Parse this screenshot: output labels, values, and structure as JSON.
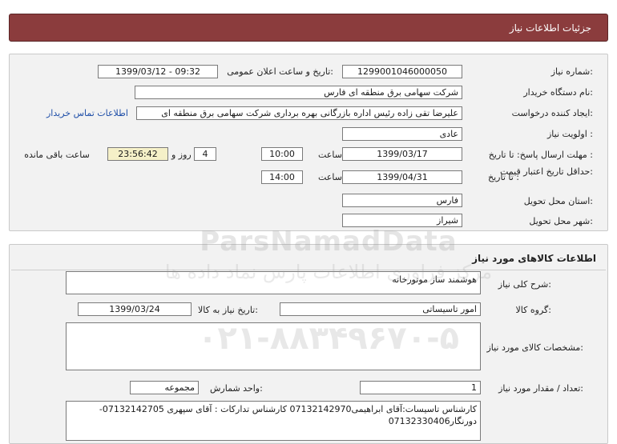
{
  "page_title": "جزئیات اطلاعات نیاز",
  "need_number": {
    "label": "شماره نیاز:",
    "value": "1299001046000050"
  },
  "announce_date": {
    "label": "تاریخ و ساعت اعلان عمومی:",
    "value": "1399/03/12 - 09:32"
  },
  "buyer_org": {
    "label": "نام دستگاه خریدار:",
    "value": "شرکت سهامی برق منطقه ای فارس"
  },
  "requester": {
    "label": "ایجاد کننده درخواست:",
    "value": "علیرضا  تقی زاده رئیس اداره بازرگانی بهره برداری شرکت سهامی برق منطقه ای",
    "contact_link": "اطلاعات تماس خریدار"
  },
  "priority": {
    "label": "اولویت نیاز :",
    "value": "عادی"
  },
  "response_deadline": {
    "label": "مهلت ارسال پاسخ:  تا تاریخ :",
    "date": "1399/03/17",
    "time_label": "ساعت",
    "time": "10:00",
    "days": "4",
    "days_label": "روز و",
    "remaining": "23:56:42",
    "remaining_label": "ساعت باقی مانده"
  },
  "price_validity": {
    "label": "حداقل تاریخ اعتبار قیمت:",
    "to_label": "تا تاریخ :",
    "date": "1399/04/31",
    "time_label": "ساعت",
    "time": "14:00"
  },
  "province": {
    "label": "استان محل تحویل:",
    "value": "فارس"
  },
  "city": {
    "label": "شهر محل تحویل:",
    "value": "شیراز"
  },
  "goods_section": {
    "title": "اطلاعات کالاهای مورد نیاز",
    "general_desc": {
      "label": "شرح کلی نیاز:",
      "value": "هوشمند ساز موتورخانه"
    },
    "goods_group": {
      "label": "گروه کالا:",
      "value": "امور تاسیساتی"
    },
    "need_date": {
      "label": "تاریخ نیاز به کالا:",
      "value": "1399/03/24"
    },
    "specs": {
      "label": "مشخصات کالای مورد نیاز:",
      "value": ""
    },
    "quantity": {
      "label": "تعداد / مقدار مورد نیاز:",
      "value": "1"
    },
    "unit": {
      "label": "واحد شمارش:",
      "value": "مجموعه"
    },
    "buyer_notes": {
      "value": "کارشناس تاسیسات:آقای ابراهیمی07132142970 کارشناس تدارکات : آقای سپهری 07132142705-دورنگار07132330406"
    }
  },
  "watermark": {
    "brand": "ParsNamadData",
    "line2": "مرکز فراوری اطلاعات پارس نماد داده ها",
    "phone": "۰۲۱-۸۸۳۴۹۶۷۰-۵"
  }
}
